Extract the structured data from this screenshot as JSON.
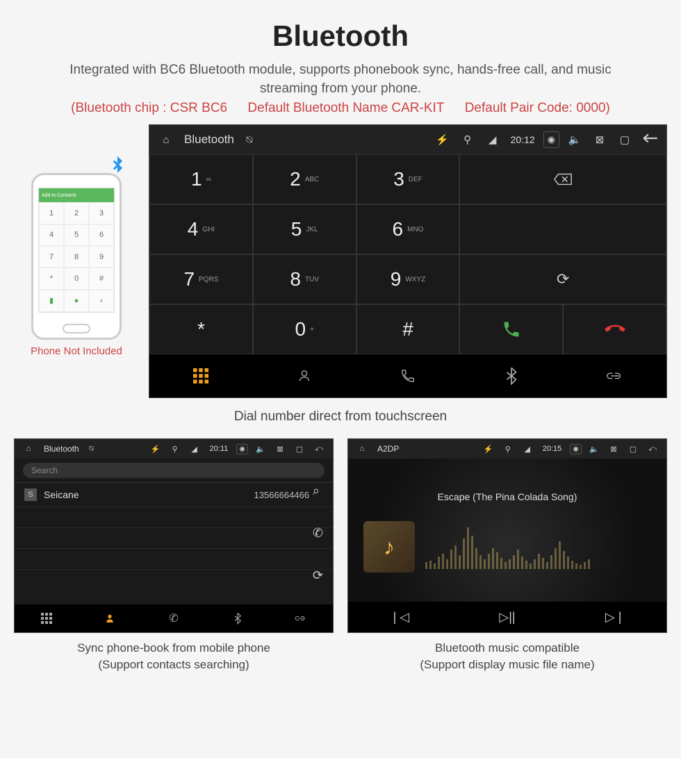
{
  "header": {
    "title": "Bluetooth",
    "subtitle": "Integrated with BC6 Bluetooth module, supports phonebook sync, hands-free call, and music streaming from your phone.",
    "spec_chip": "(Bluetooth chip : CSR BC6",
    "spec_name": "Default Bluetooth Name CAR-KIT",
    "spec_code": "Default Pair Code: 0000)"
  },
  "phone_mock": {
    "add_contacts": "Add to Contacts",
    "caption": "Phone Not Included"
  },
  "dial_screen": {
    "statusbar": {
      "title": "Bluetooth",
      "time": "20:12"
    },
    "keys": [
      {
        "num": "1",
        "letters": "∞"
      },
      {
        "num": "2",
        "letters": "ABC"
      },
      {
        "num": "3",
        "letters": "DEF"
      },
      {
        "num": "4",
        "letters": "GHI"
      },
      {
        "num": "5",
        "letters": "JKL"
      },
      {
        "num": "6",
        "letters": "MNO"
      },
      {
        "num": "7",
        "letters": "PQRS"
      },
      {
        "num": "8",
        "letters": "TUV"
      },
      {
        "num": "9",
        "letters": "WXYZ"
      },
      {
        "num": "*",
        "letters": ""
      },
      {
        "num": "0",
        "letters": "+"
      },
      {
        "num": "#",
        "letters": ""
      }
    ],
    "caption": "Dial number direct from touchscreen"
  },
  "contacts_screen": {
    "statusbar": {
      "title": "Bluetooth",
      "time": "20:11"
    },
    "search_placeholder": "Search",
    "contacts": [
      {
        "badge": "S",
        "name": "Seicane",
        "phone": "13566664466"
      }
    ],
    "caption_line1": "Sync phone-book from mobile phone",
    "caption_line2": "(Support contacts searching)"
  },
  "music_screen": {
    "statusbar": {
      "title": "A2DP",
      "time": "20:15"
    },
    "song": "Escape (The Pina Colada Song)",
    "caption_line1": "Bluetooth music compatible",
    "caption_line2": "(Support display music file name)"
  }
}
